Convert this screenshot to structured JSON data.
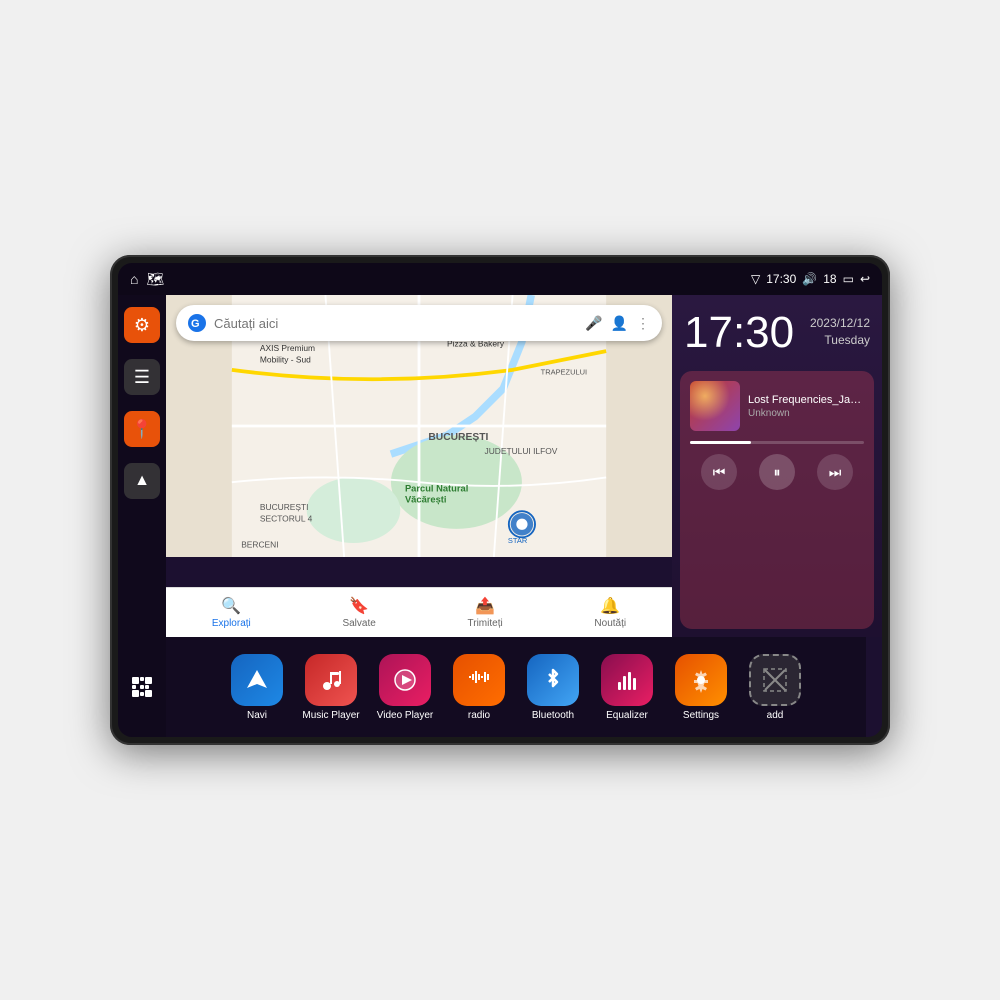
{
  "device": {
    "screen": {
      "background": "#1c1030"
    }
  },
  "status_bar": {
    "wifi_icon": "▼",
    "time": "17:30",
    "volume_icon": "🔊",
    "battery_level": "18",
    "battery_icon": "🔋",
    "back_icon": "↩"
  },
  "sidebar": {
    "items": [
      {
        "id": "settings",
        "icon": "⚙",
        "color": "orange"
      },
      {
        "id": "archive",
        "icon": "☰",
        "color": "dark"
      },
      {
        "id": "location",
        "icon": "📍",
        "color": "orange"
      },
      {
        "id": "navigation",
        "icon": "▲",
        "color": "dark"
      }
    ],
    "apps_grid_icon": "⋮⋮⋮"
  },
  "map": {
    "search_placeholder": "Căutați aici",
    "bottom_nav": [
      {
        "label": "Explorați",
        "icon": "🔍"
      },
      {
        "label": "Salvate",
        "icon": "🔖"
      },
      {
        "label": "Trimiteți",
        "icon": "📤"
      },
      {
        "label": "Noutăți",
        "icon": "🔔"
      }
    ],
    "labels": [
      "AXIS Premium Mobility - Sud",
      "Pizza & Bakery",
      "Parcul Natural Văcărești",
      "BUCUREȘTI",
      "SECTORUL 4",
      "BERCENI",
      "JUDEȚULUI ILFOV",
      "TRAPEZULUI"
    ]
  },
  "clock": {
    "time": "17:30",
    "date": "2023/12/12",
    "day": "Tuesday"
  },
  "music": {
    "title": "Lost Frequencies_Janie...",
    "artist": "Unknown",
    "controls": {
      "prev_label": "⏮",
      "pause_label": "⏸",
      "next_label": "⏭"
    }
  },
  "apps": [
    {
      "id": "navi",
      "label": "Navi",
      "icon": "▲",
      "color_class": "app-icon-navi"
    },
    {
      "id": "music-player",
      "label": "Music Player",
      "icon": "♪",
      "color_class": "app-icon-music"
    },
    {
      "id": "video-player",
      "label": "Video Player",
      "icon": "▶",
      "color_class": "app-icon-video"
    },
    {
      "id": "radio",
      "label": "radio",
      "icon": "📶",
      "color_class": "app-icon-radio"
    },
    {
      "id": "bluetooth",
      "label": "Bluetooth",
      "icon": "B",
      "color_class": "app-icon-bt"
    },
    {
      "id": "equalizer",
      "label": "Equalizer",
      "icon": "≡",
      "color_class": "app-icon-eq"
    },
    {
      "id": "settings",
      "label": "Settings",
      "icon": "⚙",
      "color_class": "app-icon-settings"
    },
    {
      "id": "add",
      "label": "add",
      "icon": "+",
      "color_class": "app-icon-add"
    }
  ]
}
